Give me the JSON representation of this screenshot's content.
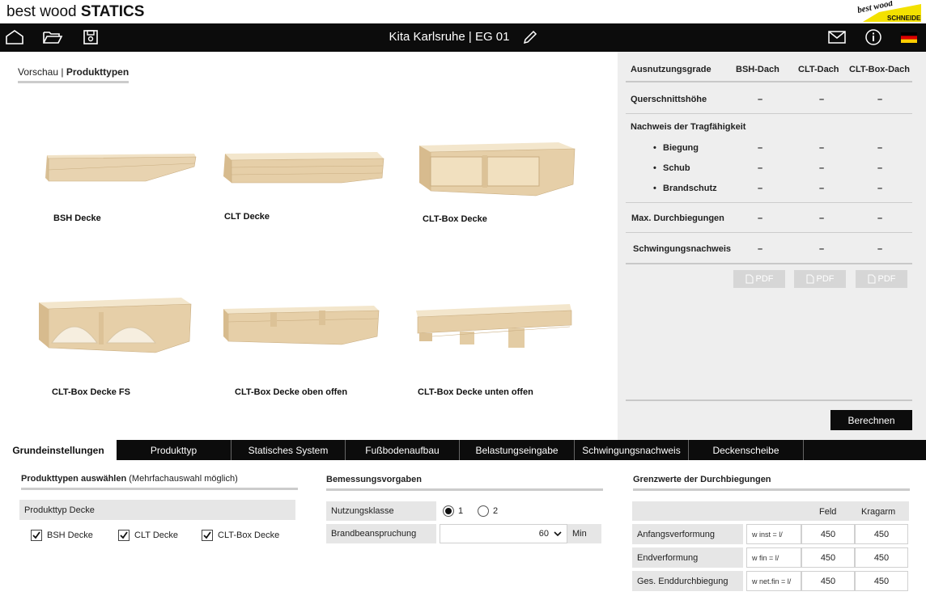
{
  "app": {
    "title_prefix": "best wood",
    "title_strong": "STATICS",
    "logo_top": "best wood",
    "logo_bottom": "SCHNEIDER"
  },
  "topbar": {
    "project_title": "Kita Karlsruhe | EG 01"
  },
  "breadcrumb": {
    "first": "Vorschau",
    "sep": " | ",
    "current": "Produkttypen"
  },
  "products": [
    {
      "label": "BSH Decke"
    },
    {
      "label": "CLT Decke"
    },
    {
      "label": "CLT-Box Decke"
    },
    {
      "label": "CLT-Box Decke FS"
    },
    {
      "label": "CLT-Box Decke oben offen"
    },
    {
      "label": "CLT-Box Decke unten offen"
    }
  ],
  "results": {
    "headers": [
      "Ausnutzungsgrade",
      "BSH-Dach",
      "CLT-Dach",
      "CLT-Box-Dach"
    ],
    "rows": [
      {
        "label": "Querschnittshöhe",
        "values": [
          "–",
          "–",
          "–"
        ]
      },
      {
        "label": "Nachweis der Tragfähigkeit",
        "values": []
      },
      {
        "label": "Biegung",
        "values": [
          "–",
          "–",
          "–"
        ]
      },
      {
        "label": "Schub",
        "values": [
          "–",
          "–",
          "–"
        ]
      },
      {
        "label": "Brandschutz",
        "values": [
          "–",
          "–",
          "–"
        ]
      },
      {
        "label": "Max. Durchbiegungen",
        "values": [
          "–",
          "–",
          "–"
        ]
      },
      {
        "label": "Schwingungsnachweis",
        "values": [
          "–",
          "–",
          "–"
        ]
      }
    ],
    "pdf_label": "PDF",
    "calc_label": "Berechnen"
  },
  "tabs": [
    "Grundeinstellungen",
    "Produkttyp",
    "Statisches System",
    "Fußbodenaufbau",
    "Belastungseingabe",
    "Schwingungsnachweis",
    "Deckenscheibe"
  ],
  "grund": {
    "heading": "Produkttypen auswählen",
    "heading_note": "(Mehrfachauswahl möglich)",
    "group_label": "Produkttyp Decke",
    "checks": [
      {
        "label": "BSH Decke",
        "checked": true
      },
      {
        "label": "CLT Decke",
        "checked": true
      },
      {
        "label": "CLT-Box Decke",
        "checked": true
      }
    ]
  },
  "bemessung": {
    "heading": "Bemessungsvorgaben",
    "nk_label": "Nutzungsklasse",
    "nk_options": [
      "1",
      "2"
    ],
    "nk_selected": "1",
    "brand_label": "Brandbeanspruchung",
    "brand_value": "60",
    "brand_unit": "Min"
  },
  "grenz": {
    "heading": "Grenzwerte der Durchbiegungen",
    "col_feld": "Feld",
    "col_krag": "Kragarm",
    "rows": [
      {
        "label": "Anfangsverformung",
        "formula": "w inst = l/",
        "feld": "450",
        "krag": "450"
      },
      {
        "label": "Endverformung",
        "formula": "w fin = l/",
        "feld": "450",
        "krag": "450"
      },
      {
        "label": "Ges. Enddurchbiegung",
        "formula": "w net.fin = l/",
        "feld": "450",
        "krag": "450"
      }
    ]
  },
  "colors": {
    "bar": "#0c0c0c",
    "panel": "#eeeeee",
    "wood": "#e8d3b0"
  }
}
